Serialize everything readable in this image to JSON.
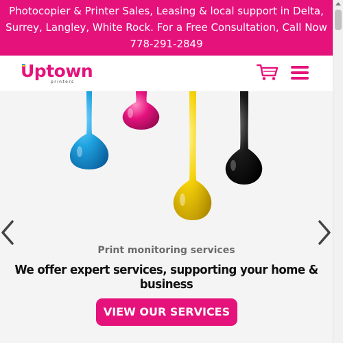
{
  "banner": {
    "line1": "Photocopier & Printer Sales, Leasing & local support in Delta,",
    "line2": "Surrey, Langley, White Rock. For a Free Consultation, Call Now",
    "line3": "778-291-2849"
  },
  "header": {
    "logo_word": "Uptown",
    "logo_sub": "printers",
    "cart_icon": "shopping-cart-icon",
    "menu_icon": "hamburger-menu-icon"
  },
  "hero": {
    "subtitle": "Print monitoring services",
    "title": "We offer expert services, supporting your home & business",
    "cta_label": "VIEW OUR SERVICES",
    "prev_icon": "chevron-left-icon",
    "next_icon": "chevron-right-icon"
  },
  "colors": {
    "brand_pink": "#e6127c",
    "cyan": "#1fa3e0",
    "magenta": "#e5127e",
    "yellow": "#f6d20a",
    "black": "#1a1a1a"
  }
}
